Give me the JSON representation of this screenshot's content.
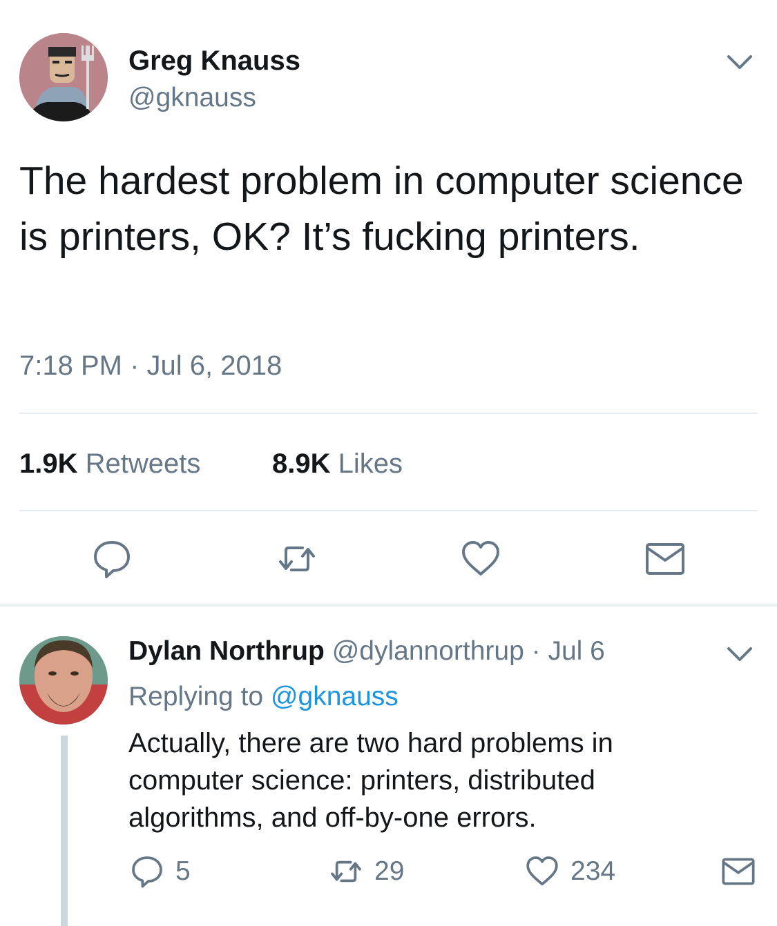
{
  "main_tweet": {
    "author": {
      "display_name": "Greg Knauss",
      "handle": "@gknauss"
    },
    "text": "The hardest problem in computer science is printers, OK? It’s fucking printers.",
    "timestamp": "7:18 PM · Jul 6, 2018",
    "stats": {
      "retweets_count": "1.9K",
      "retweets_label": "Retweets",
      "likes_count": "8.9K",
      "likes_label": "Likes"
    },
    "actions": [
      "reply-icon",
      "retweet-icon",
      "like-icon",
      "dm-icon"
    ]
  },
  "reply_tweet": {
    "author": {
      "display_name": "Dylan Northrup",
      "handle": "@dylannorthrup",
      "date": " · Jul 6"
    },
    "replying_prefix": "Replying to ",
    "replying_to": "@gknauss",
    "text": "Actually, there are two hard problems in computer science: printers, distributed algorithms, and off-by-one errors.",
    "counts": {
      "replies": "5",
      "retweets": "29",
      "likes": "234"
    }
  },
  "colors": {
    "text": "#14171a",
    "secondary": "#657786",
    "link": "#1b95e0",
    "divider": "#e6ecf0",
    "thread_line": "#ccd6dd"
  }
}
